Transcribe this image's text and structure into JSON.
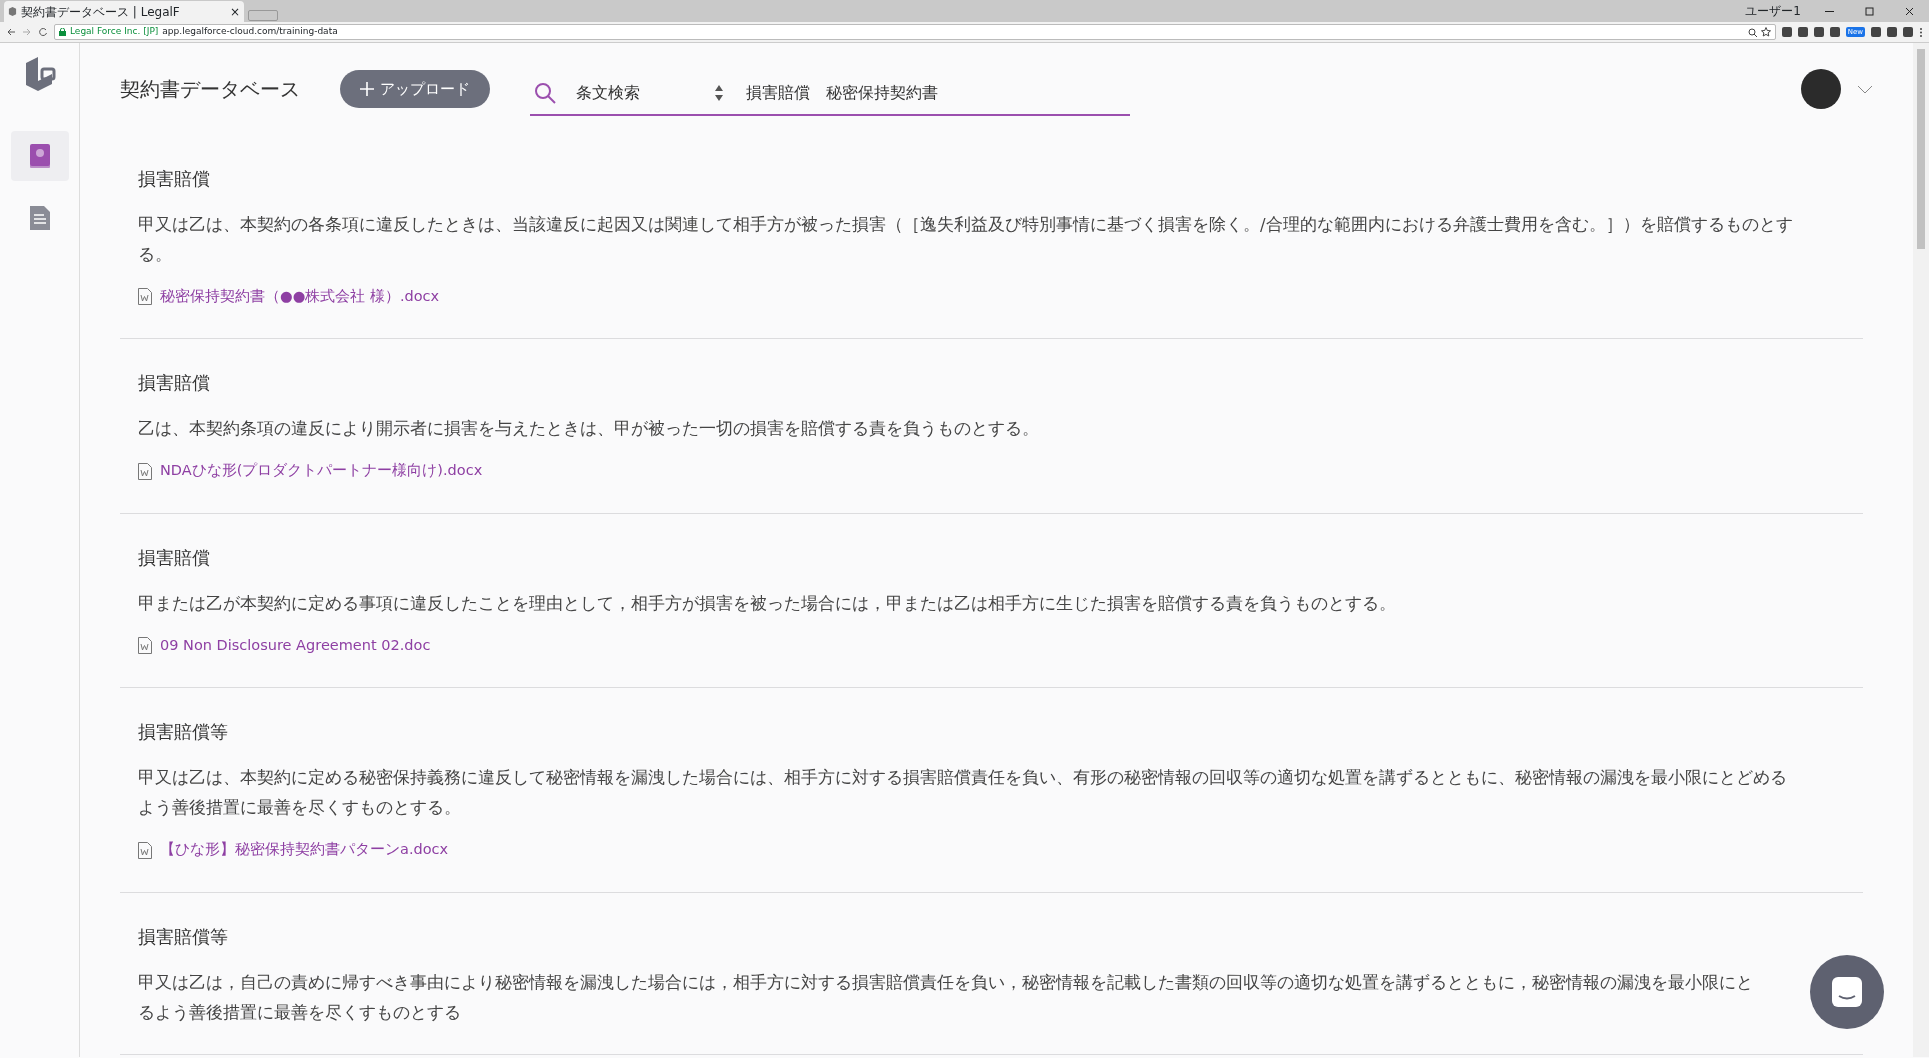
{
  "browser": {
    "tab_title": "契約書データベース | LegalF",
    "tab_close": "×",
    "site_identity": "Legal Force Inc. [JP]",
    "url": "app.legalforce-cloud.com/training-data",
    "user": "ユーザー1",
    "extension_badge": "New"
  },
  "sidebar": {
    "items": [
      {
        "kind": "book",
        "selected": true
      },
      {
        "kind": "document",
        "selected": false
      }
    ]
  },
  "header": {
    "title": "契約書データベース",
    "upload_button": "アップロード",
    "search_mode": "条文検索",
    "search_query": "損害賠償　秘密保持契約書"
  },
  "results": [
    {
      "title": "損害賠償",
      "lines": [
        "甲又は乙は、本契約の各条項に違反したときは、当該違反に起因又は関連して相手方が被った損害（［逸失利益及び特別事情に基づく損害を除く。/合理的な範囲内における弁護士費用を含む。］）を賠償するものとす",
        "る。"
      ],
      "file": "秘密保持契約書（●●株式会社 様）.docx"
    },
    {
      "title": "損害賠償",
      "lines": [
        "乙は、本契約条項の違反により開示者に損害を与えたときは、甲が被った一切の損害を賠償する責を負うものとする。"
      ],
      "file": "NDAひな形(プロダクトパートナー様向け).docx"
    },
    {
      "title": "損害賠償",
      "lines": [
        "甲または乙が本契約に定める事項に違反したことを理由として，相手方が損害を被った場合には，甲または乙は相手方に生じた損害を賠償する責を負うものとする。"
      ],
      "file": "09 Non Disclosure Agreement 02.doc"
    },
    {
      "title": "損害賠償等",
      "lines": [
        "甲又は乙は、本契約に定める秘密保持義務に違反して秘密情報を漏洩した場合には、相手方に対する損害賠償責任を負い、有形の秘密情報の回収等の適切な処置を講ずるとともに、秘密情報の漏洩を最小限にとどめる",
        "よう善後措置に最善を尽くすものとする。"
      ],
      "file": "【ひな形】秘密保持契約書パターンa.docx"
    },
    {
      "title": "損害賠償等",
      "lines": [
        "甲又は乙は，自己の責めに帰すべき事由により秘密情報を漏洩した場合には，相手方に対する損害賠償責任を負い，秘密情報を記載した書類の回収等の適切な処置を講ずるとともに，秘密情報の漏洩を最小限にと",
        "るよう善後措置に最善を尽くすものとする"
      ]
    }
  ]
}
